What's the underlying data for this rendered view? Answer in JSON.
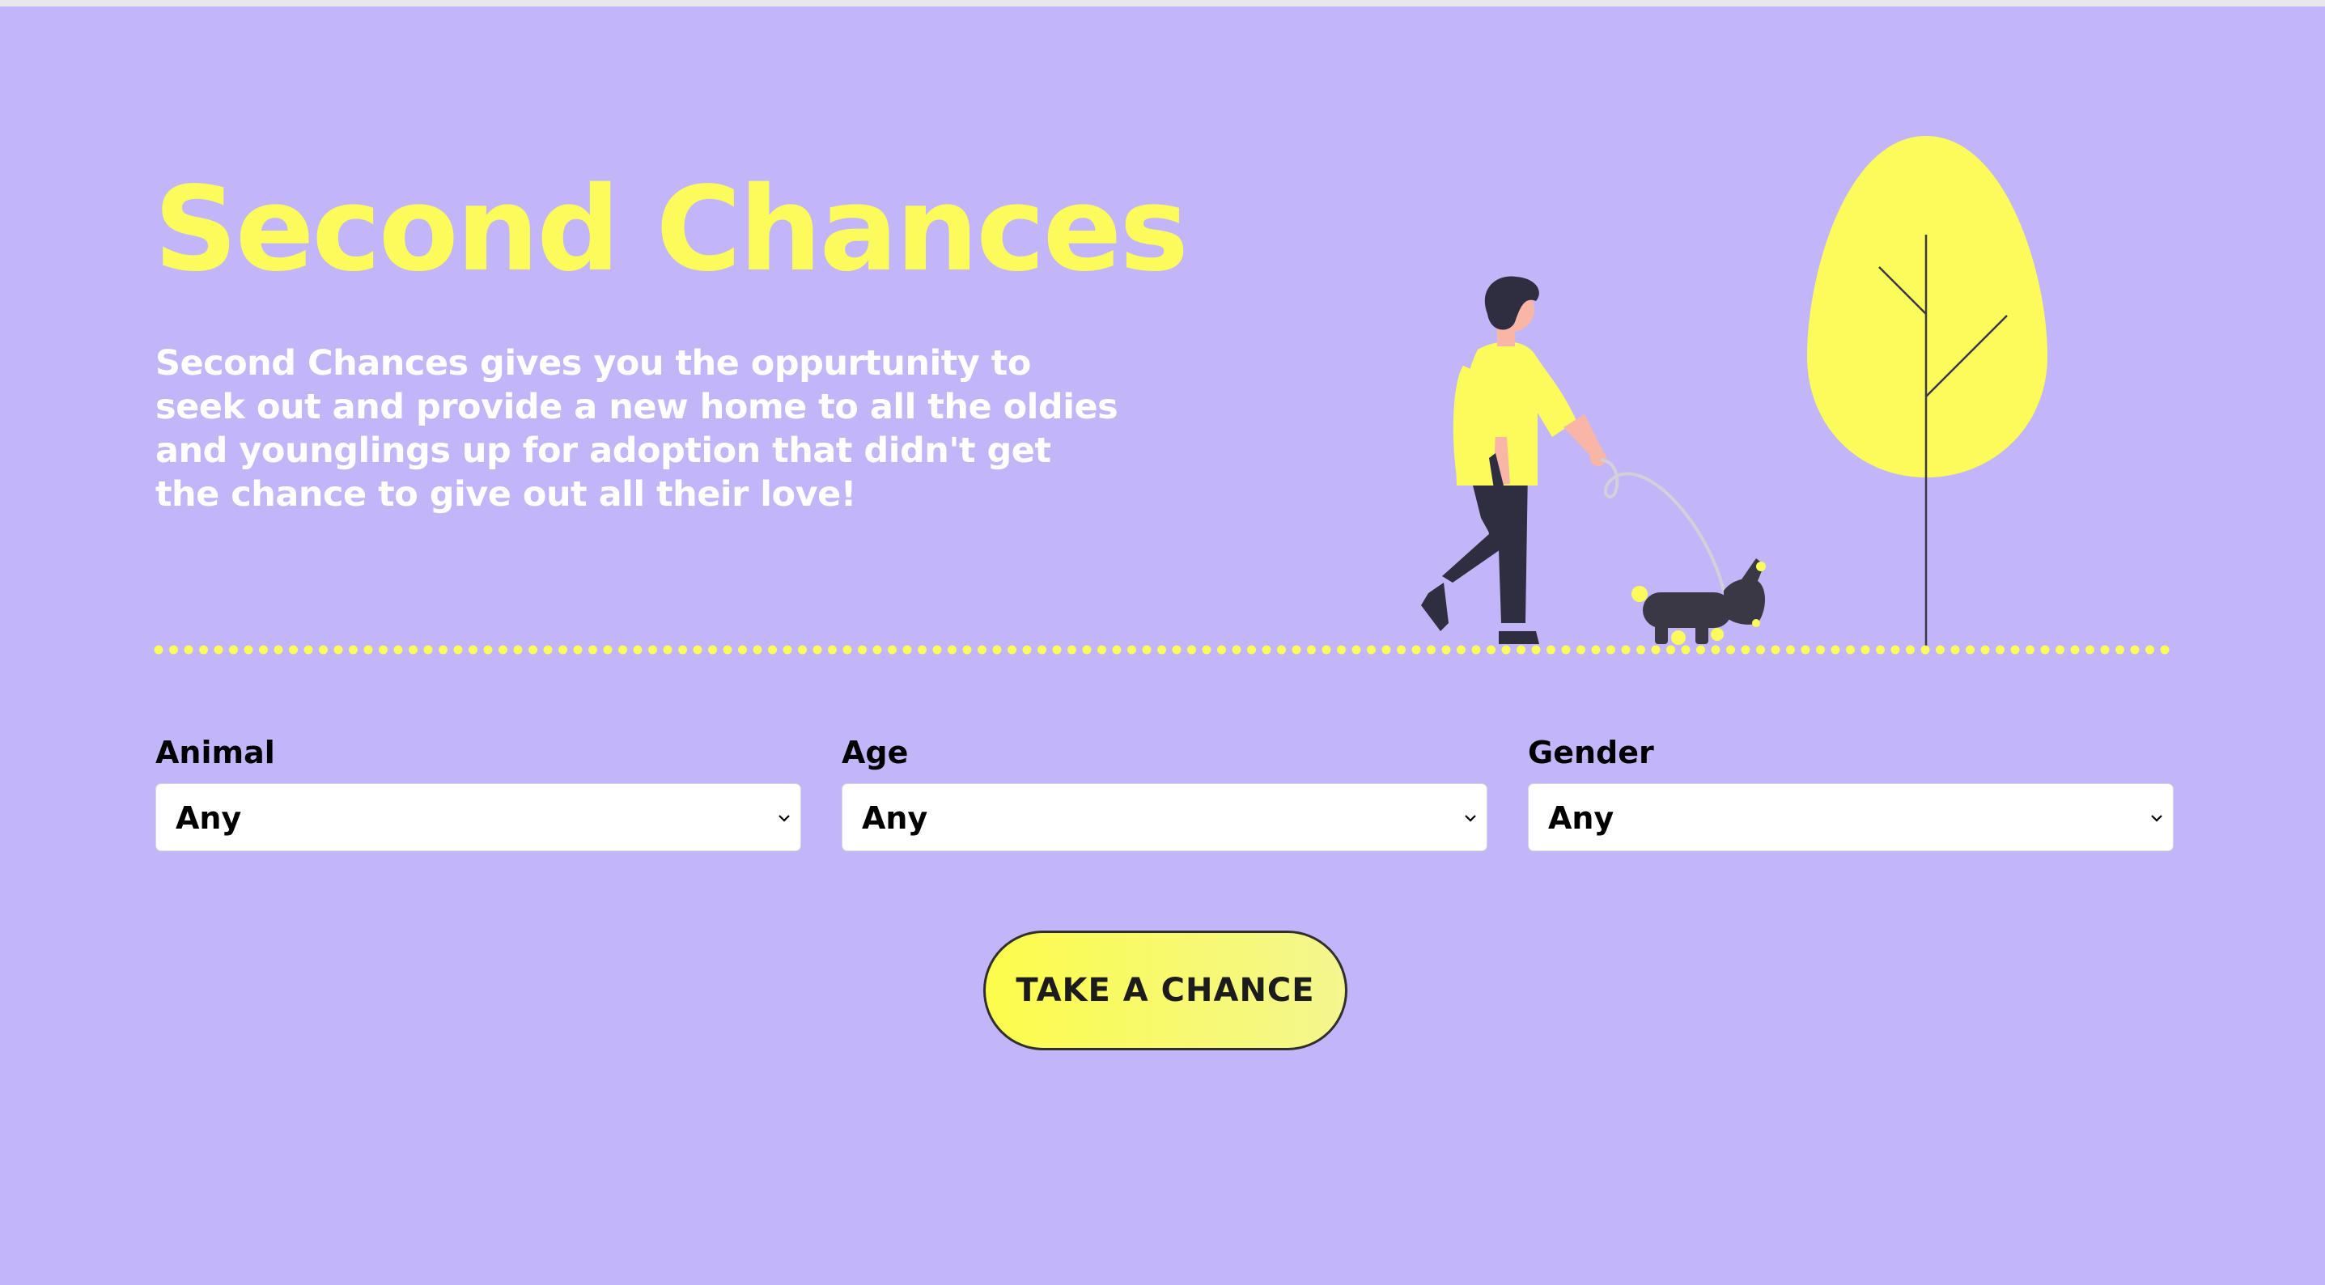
{
  "hero": {
    "title": "Second Chances",
    "description": "Second Chances gives you the oppurtunity to seek out and provide a new home to all the oldies and younglings up for adoption that didn't get the chance to give out all their love!"
  },
  "illustration": {
    "subject": "person-walking-dog-with-tree",
    "icons": [
      "person-icon",
      "dog-icon",
      "tree-icon"
    ]
  },
  "filters": [
    {
      "label": "Animal",
      "value": "Any"
    },
    {
      "label": "Age",
      "value": "Any"
    },
    {
      "label": "Gender",
      "value": "Any"
    }
  ],
  "cta": {
    "label": "TAKE A CHANCE"
  },
  "colors": {
    "background": "#c3b6f8",
    "accent_yellow": "#fbfc5b",
    "dark": "#3a3845",
    "white": "#ffffff"
  }
}
